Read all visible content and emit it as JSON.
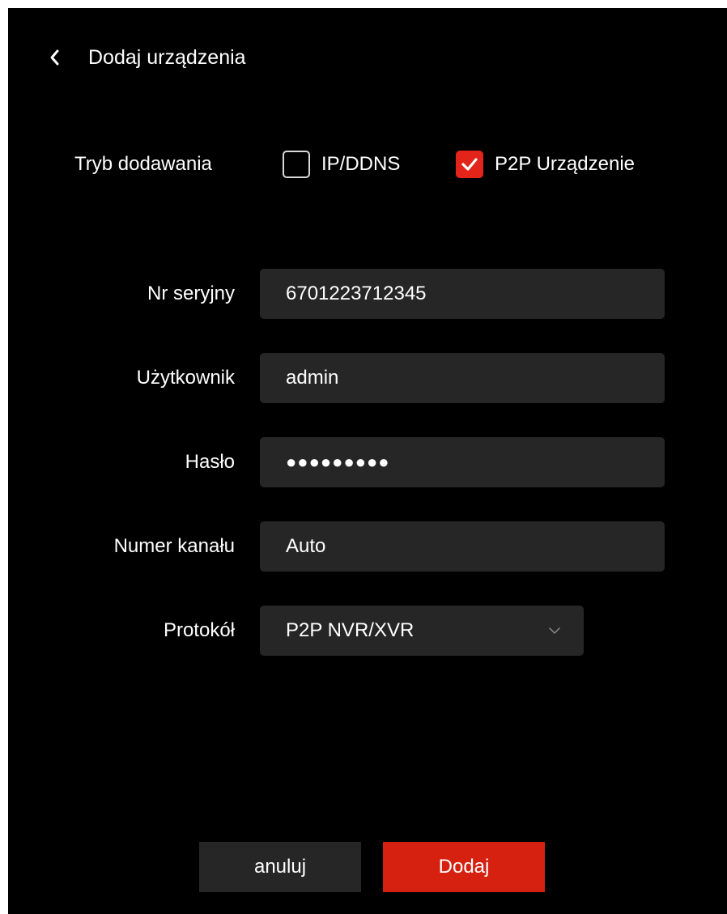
{
  "header": {
    "title": "Dodaj urządzenia",
    "back_icon": "chevron-left-icon"
  },
  "mode": {
    "label": "Tryb dodawania",
    "options": [
      {
        "label": "IP/DDNS",
        "checked": false
      },
      {
        "label": "P2P Urządzenie",
        "checked": true
      }
    ]
  },
  "fields": {
    "serial": {
      "label": "Nr seryjny",
      "value": "6701223712345"
    },
    "user": {
      "label": "Użytkownik",
      "value": "admin"
    },
    "password": {
      "label": "Hasło",
      "value": "●●●●●●●●●"
    },
    "channel": {
      "label": "Numer kanału",
      "value": "Auto"
    },
    "protocol": {
      "label": "Protokół",
      "value": "P2P NVR/XVR",
      "icon": "chevron-down-icon"
    }
  },
  "buttons": {
    "cancel": "anuluj",
    "add": "Dodaj"
  },
  "colors": {
    "background": "#000000",
    "field_background": "#262626",
    "accent": "#e3241a",
    "primary_button": "#d62010",
    "text": "#ffffff"
  }
}
